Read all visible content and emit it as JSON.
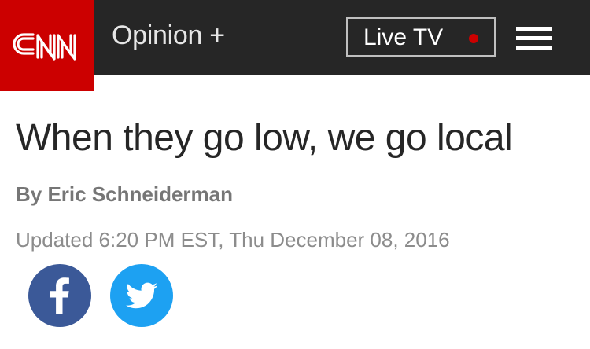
{
  "header": {
    "logo_text": "CNN",
    "section_label": "Opinion +",
    "live_tv_label": "Live TV",
    "menu_icon": "hamburger-menu-icon",
    "live_indicator_color": "#cc0000",
    "brand_color": "#cc0000",
    "bar_color": "#262626"
  },
  "article": {
    "headline": "When they go low, we go local",
    "byline": "By Eric Schneiderman",
    "updated": "Updated 6:20 PM EST, Thu December 08, 2016"
  },
  "share": {
    "facebook_icon": "facebook-icon",
    "twitter_icon": "twitter-icon",
    "facebook_color": "#3b5998",
    "twitter_color": "#1da1f2"
  }
}
